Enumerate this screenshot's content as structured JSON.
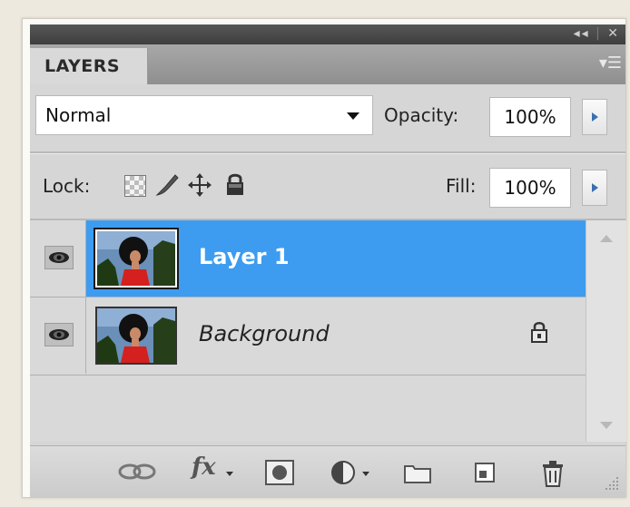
{
  "panel": {
    "tab_label": "LAYERS",
    "menu_glyph": "▾☰",
    "title_controls": [
      "◂◂",
      "✕"
    ]
  },
  "blend": {
    "mode": "Normal",
    "opacity_label": "Opacity:",
    "opacity_value": "100%"
  },
  "lock": {
    "label": "Lock:",
    "fill_label": "Fill:",
    "fill_value": "100%"
  },
  "layers": [
    {
      "name": "Layer 1",
      "selected": true,
      "locked": false
    },
    {
      "name": "Background",
      "selected": false,
      "locked": true
    }
  ],
  "bottom_icons": [
    "link-layers-icon",
    "fx-icon",
    "mask-icon",
    "adjustment-icon",
    "group-folder-icon",
    "new-layer-icon",
    "trash-icon"
  ],
  "bottom_fx_label": "fx",
  "colors": {
    "selection": "#3d9cf0",
    "panel_bg": "#d6d6d6",
    "arrow_blue": "#3a6fb0"
  }
}
